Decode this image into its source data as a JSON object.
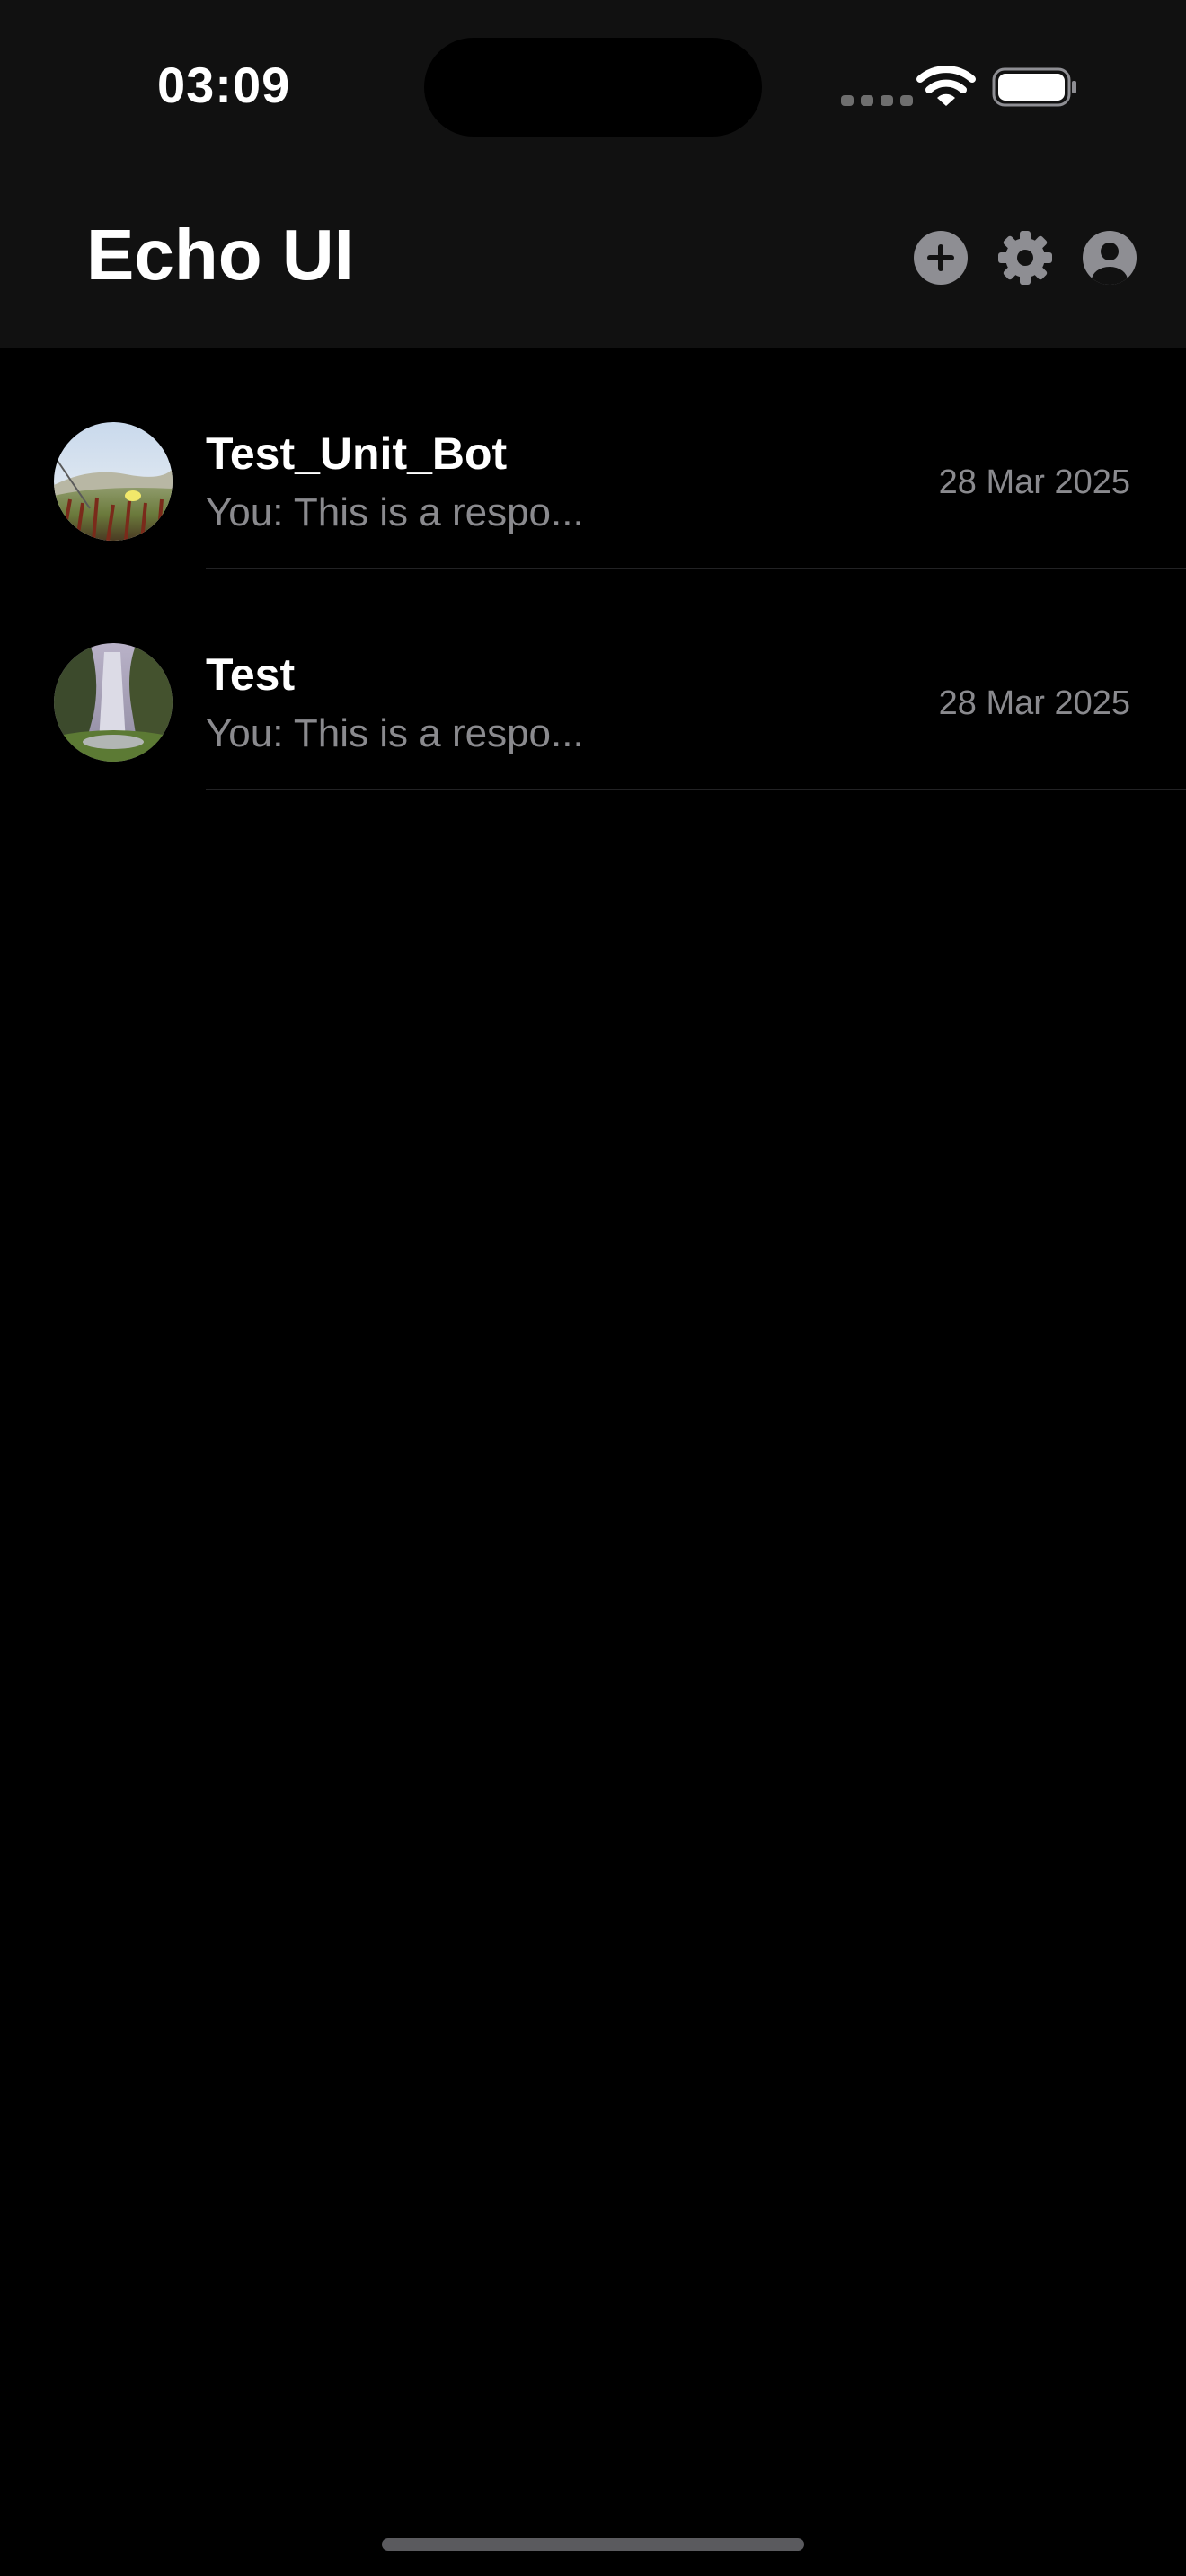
{
  "status_bar": {
    "time": "03:09",
    "wifi_icon": "wifi-icon",
    "battery_icon": "battery-icon",
    "signal_icon": "cellular-signal-icon"
  },
  "header": {
    "title": "Echo UI",
    "actions": [
      {
        "icon": "plus-circle-icon"
      },
      {
        "icon": "gear-icon"
      },
      {
        "icon": "person-circle-icon"
      }
    ]
  },
  "chats": [
    {
      "name": "Test_Unit_Bot",
      "preview": "You: This is a respo...",
      "date": "28 Mar 2025",
      "avatar": "meadow-photo-avatar"
    },
    {
      "name": "Test",
      "preview": "You: This is a respo...",
      "date": "28 Mar 2025",
      "avatar": "waterfall-photo-avatar"
    }
  ],
  "colors": {
    "background": "#000000",
    "header_background": "#111111",
    "secondary_text": "#8a8a8e",
    "icon_gray": "#8e8e93",
    "divider": "#222224"
  }
}
